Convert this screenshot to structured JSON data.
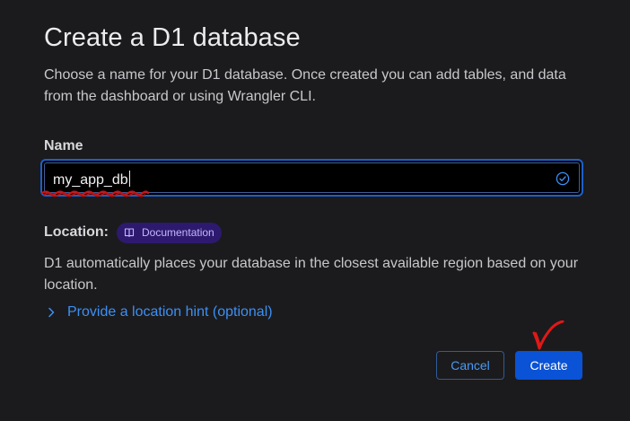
{
  "dialog": {
    "title": "Create a D1 database",
    "description": "Choose a name for your D1 database. Once created you can add tables, and data from the dashboard or using Wrangler CLI."
  },
  "name_field": {
    "label": "Name",
    "value": "my_app_db",
    "valid_icon": "check-circle-icon"
  },
  "location": {
    "label": "Location:",
    "doc_badge_label": "Documentation",
    "doc_badge_icon": "book-icon",
    "description": "D1 automatically places your database in the closest available region based on your location.",
    "hint_link_label": "Provide a location hint (optional)",
    "hint_link_icon": "chevron-right-icon"
  },
  "actions": {
    "cancel_label": "Cancel",
    "create_label": "Create"
  },
  "colors": {
    "background": "#1b1b1d",
    "accent": "#0a52d6",
    "link": "#3d8ff5",
    "badge_bg": "#2d1a6e",
    "badge_text": "#c4b5fd",
    "annotation_red": "#e01818"
  }
}
